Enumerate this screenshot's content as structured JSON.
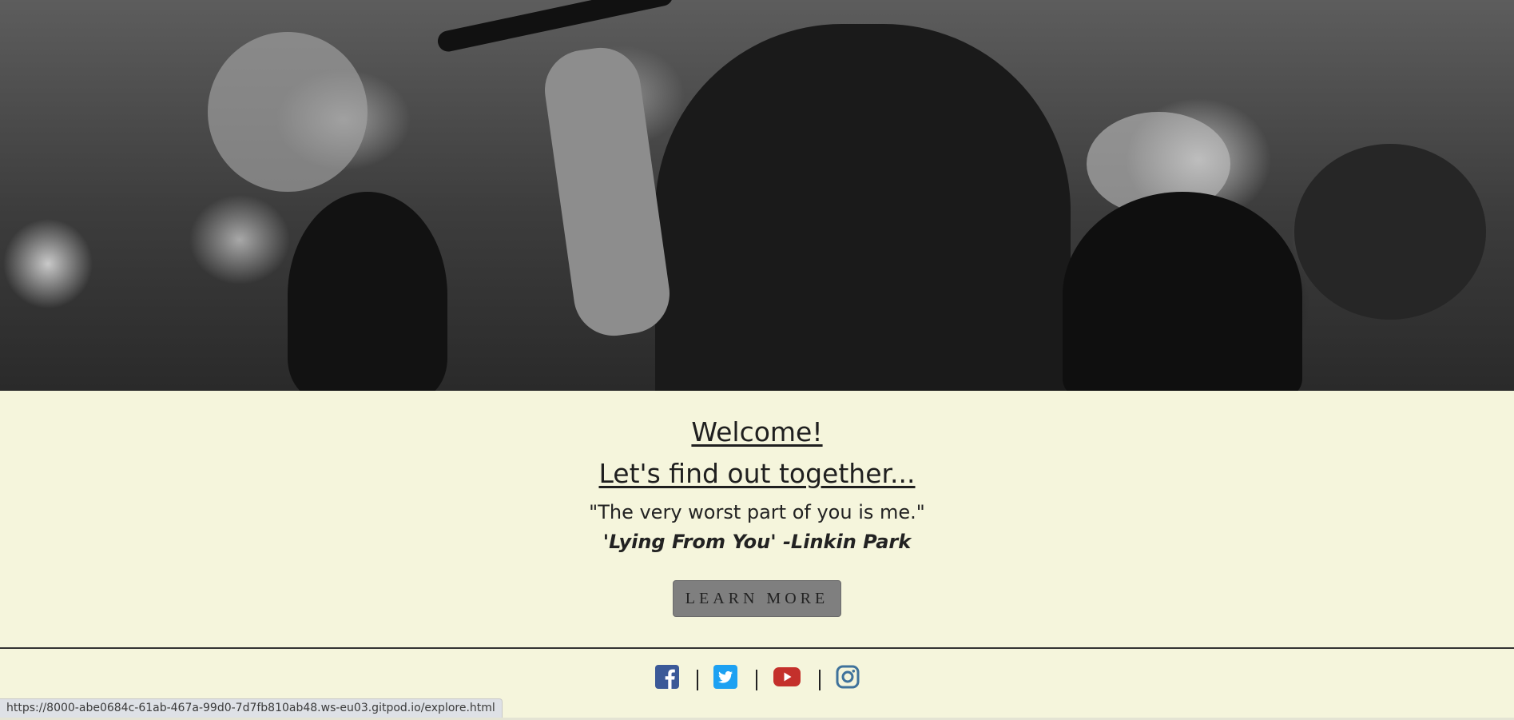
{
  "hero": {
    "image_alt": "Black and white photo of a singer performing with the crowd"
  },
  "welcome": {
    "heading_1": "Welcome!",
    "heading_2": "Let's find out together...",
    "quote": "\"The very worst part of you is me.\"",
    "quote_source": "'Lying From You' -Linkin Park",
    "button_label": "LEARN MORE"
  },
  "footer": {
    "social": [
      {
        "name": "facebook",
        "icon": "facebook-icon",
        "color": "#3b5998"
      },
      {
        "name": "twitter",
        "icon": "twitter-icon",
        "color": "#1da1f2"
      },
      {
        "name": "youtube",
        "icon": "youtube-icon",
        "color": "#c4302b"
      },
      {
        "name": "instagram",
        "icon": "instagram-icon",
        "color": "#3f729b"
      }
    ]
  },
  "status_bar": {
    "url": "https://8000-abe0684c-61ab-467a-99d0-7d7fb810ab48.ws-eu03.gitpod.io/explore.html"
  },
  "colors": {
    "page_background": "#f5f5dc",
    "button_background": "#7f7f7f",
    "text": "#1f1f1f"
  }
}
